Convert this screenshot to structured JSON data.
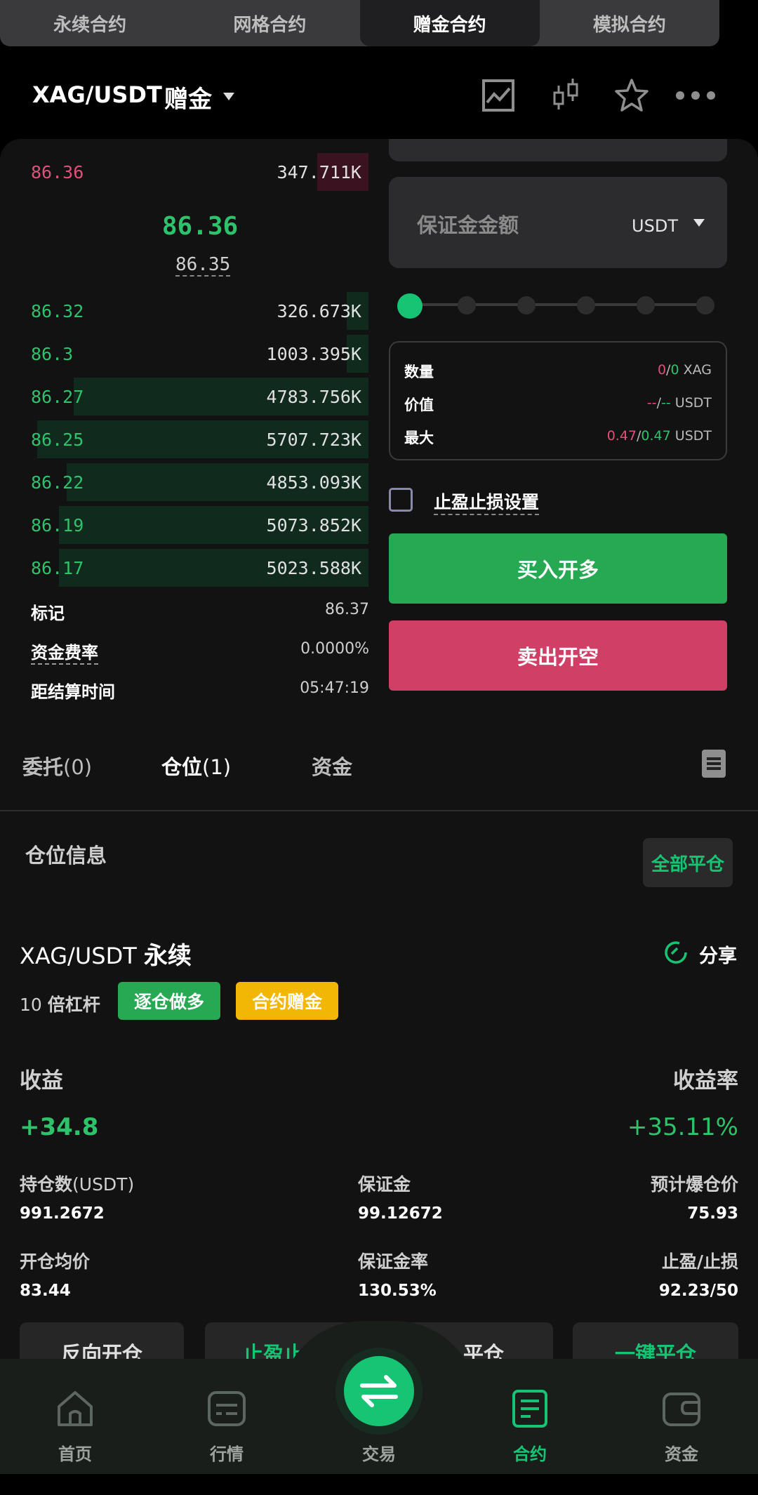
{
  "top_tabs": [
    {
      "label": "永续合约"
    },
    {
      "label": "网格合约"
    },
    {
      "label": "赠金合约",
      "active": true
    },
    {
      "label": "模拟合约"
    }
  ],
  "header": {
    "pair": "XAG/USDT",
    "mode": "赠金",
    "icons": [
      "chart-icon",
      "candlestick-icon",
      "star-icon",
      "more-icon"
    ]
  },
  "orderbook": {
    "asks": [
      {
        "price": "86.36",
        "size": "347.711K",
        "depth": 0.14
      }
    ],
    "mid_price": "86.36",
    "mark_price": "86.35",
    "bids": [
      {
        "price": "86.32",
        "size": "326.673K",
        "depth": 0.06
      },
      {
        "price": "86.3",
        "size": "1003.395K",
        "depth": 0.06
      },
      {
        "price": "86.27",
        "size": "4783.756K",
        "depth": 0.8
      },
      {
        "price": "86.25",
        "size": "5707.723K",
        "depth": 0.9
      },
      {
        "price": "86.22",
        "size": "4853.093K",
        "depth": 0.82
      },
      {
        "price": "86.19",
        "size": "5073.852K",
        "depth": 0.84
      },
      {
        "price": "86.17",
        "size": "5023.588K",
        "depth": 0.84
      }
    ]
  },
  "market_info": {
    "mark_label": "标记",
    "mark_value": "86.37",
    "funding_label": "资金费率",
    "funding_value": "0.0000%",
    "settle_label": "距结算时间",
    "settle_value": "05:47:19"
  },
  "order_form": {
    "margin_placeholder": "保证金金额",
    "unit": "USDT",
    "slider_level": 0,
    "qty_label": "数量",
    "qty_a": "0",
    "qty_sep": "/",
    "qty_b": "0",
    "qty_unit": "XAG",
    "value_label": "价值",
    "value_a": "--",
    "value_sep": "/",
    "value_b": "--",
    "value_unit": "USDT",
    "max_label": "最大",
    "max_a": "0.47",
    "max_sep": "/",
    "max_b": "0.47",
    "max_unit": "USDT",
    "tpsl_label": "止盈止损设置",
    "buy_label": "买入开多",
    "sell_label": "卖出开空"
  },
  "sub_tabs": [
    {
      "label": "委托",
      "count": "(0)"
    },
    {
      "label": "仓位",
      "count": "(1)",
      "active": true
    },
    {
      "label": "资金",
      "count": ""
    }
  ],
  "position": {
    "section_title": "仓位信息",
    "close_all_label": "全部平仓",
    "pair": "XAG/USDT",
    "pair_type": "永续",
    "share_label": "分享",
    "leverage_num": "10",
    "leverage_label": "倍杠杆",
    "tag_side": "逐仓做多",
    "tag_bonus": "合约赠金",
    "pnl_label": "收益",
    "pnl_value": "+34.8",
    "roe_label": "收益率",
    "roe_value": "+35.11%",
    "holding_label": "持仓数",
    "holding_unit": "(USDT)",
    "holding_value": "991.2672",
    "margin_label": "保证金",
    "margin_value": "99.12672",
    "liq_label": "预计爆仓价",
    "liq_value": "75.93",
    "entry_label": "开仓均价",
    "entry_value": "83.44",
    "margin_rate_label": "保证金率",
    "margin_rate_value": "130.53%",
    "tpsl_label": "止盈/止损",
    "tpsl_value": "92.23/50"
  },
  "action_buttons": [
    "反向开仓",
    "止盈止",
    "平仓",
    "一键平仓"
  ],
  "bottom_nav": [
    {
      "label": "首页"
    },
    {
      "label": "行情"
    },
    {
      "label": "交易"
    },
    {
      "label": "合约",
      "active": true
    },
    {
      "label": "资金"
    }
  ],
  "colors": {
    "accent_green": "#17c473",
    "up_green": "#2ec36b",
    "down_red": "#e0517a",
    "buy": "#27a853",
    "sell": "#d03f66",
    "tag_yellow": "#f2b705"
  }
}
